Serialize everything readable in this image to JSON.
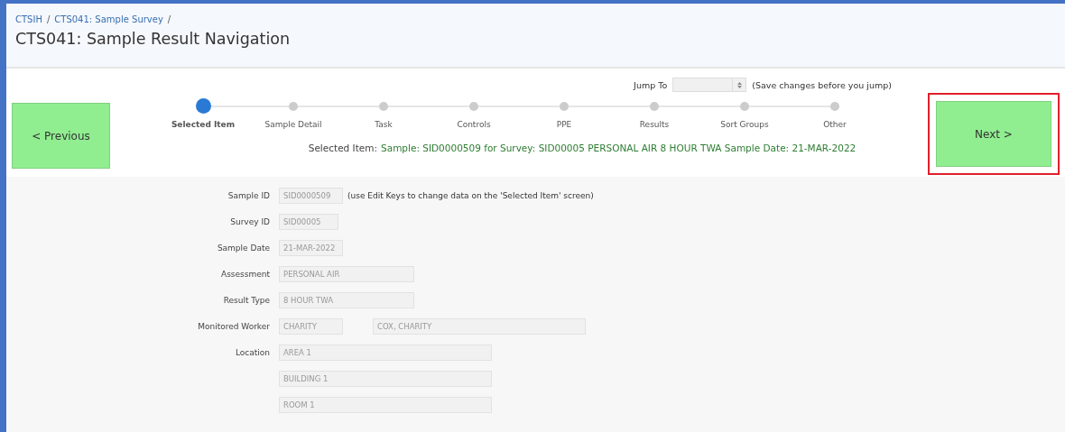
{
  "breadcrumb": [
    {
      "label": "CTSIH",
      "separator": "/"
    },
    {
      "label": "CTS041: Sample Survey",
      "separator": "/"
    }
  ],
  "title": "CTS041: Sample Result Navigation",
  "jump": {
    "label": "Jump To",
    "note": "(Save changes before you jump)"
  },
  "previous_button": {
    "label": "< Previous"
  },
  "next_button": {
    "label": "Next >",
    "highlighted": true
  },
  "steps": [
    {
      "label": "Selected Item",
      "selected": true
    },
    {
      "label": "Sample Detail",
      "selected": false
    },
    {
      "label": "Task",
      "selected": false
    },
    {
      "label": "Controls",
      "selected": false
    },
    {
      "label": "PPE",
      "selected": false
    },
    {
      "label": "Results",
      "selected": false
    },
    {
      "label": "Sort Groups",
      "selected": false
    },
    {
      "label": "Other",
      "selected": false
    }
  ],
  "summary": {
    "label": "Selected Item:",
    "value": "Sample: SID0000509 for Survey: SID00005 PERSONAL AIR 8 HOUR TWA Sample Date: 21-MAR-2022"
  },
  "fields": [
    {
      "label": "Sample ID",
      "values": [
        {
          "value": "SID0000509",
          "disabled": true
        }
      ],
      "note": "(use Edit Keys to change data on the 'Selected Item' screen)"
    },
    {
      "label": "Survey ID",
      "values": [
        {
          "value": "SID00005",
          "disabled": true
        }
      ]
    },
    {
      "label": "Sample Date",
      "values": [
        {
          "value": "21-MAR-2022",
          "disabled": true
        }
      ]
    },
    {
      "label": "Assessment",
      "values": [
        {
          "value": "PERSONAL AIR",
          "disabled": true
        }
      ]
    },
    {
      "label": "Result Type",
      "values": [
        {
          "value": "8 HOUR TWA",
          "disabled": true
        }
      ]
    },
    {
      "label": "Monitored Worker",
      "values": [
        {
          "value": "CHARITY",
          "disabled": true
        },
        {
          "value": "COX, CHARITY",
          "disabled": true
        }
      ]
    },
    {
      "label": "Location",
      "values": [
        {
          "value": "AREA 1",
          "disabled": true
        }
      ]
    },
    {
      "values": [
        {
          "value": "BUILDING 1",
          "disabled": true
        }
      ]
    },
    {
      "values": [
        {
          "value": "ROOM 1",
          "disabled": true
        }
      ]
    }
  ]
}
